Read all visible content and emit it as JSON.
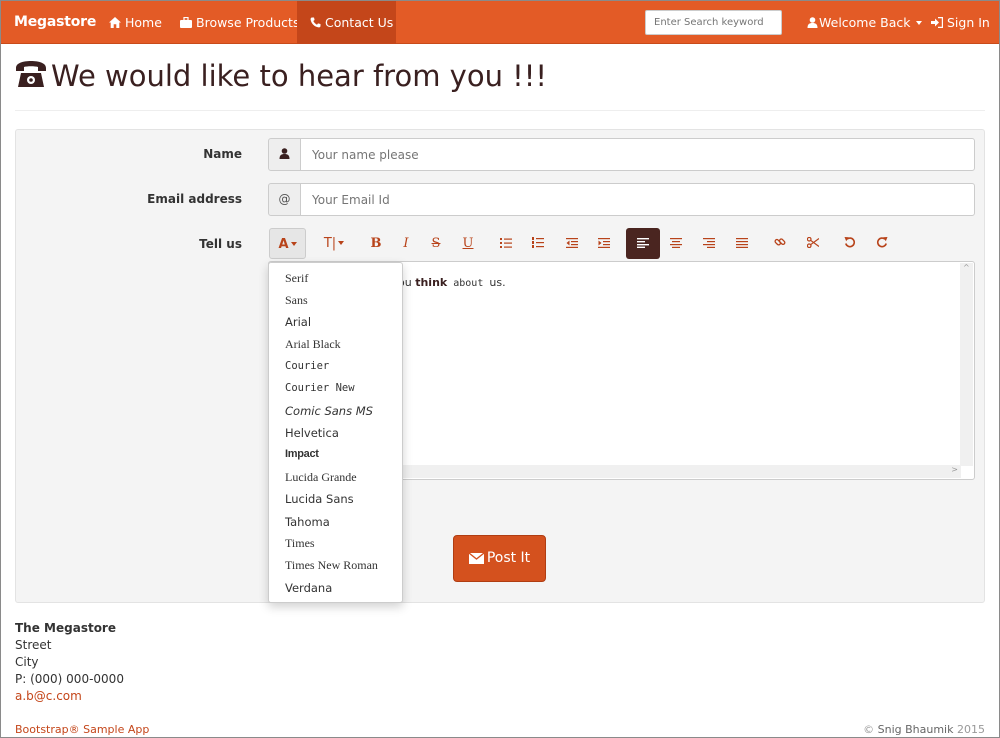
{
  "navbar": {
    "brand": "Megastore",
    "home": "Home",
    "browse": "Browse Products",
    "contact": "Contact Us",
    "search_placeholder": "Enter Search keyword",
    "welcome": "Welcome Back",
    "signin": "Sign In",
    "accent": "#e35b26"
  },
  "heading": {
    "title": "We would like to hear from you !!!"
  },
  "form": {
    "name_label": "Name",
    "name_placeholder": "Your name please",
    "email_label": "Email address",
    "email_addon": "@",
    "email_placeholder": "Your Email Id",
    "tell_label": "Tell us",
    "editor_text_a": "ou ",
    "editor_text_bold": "think",
    "editor_text_mono": " about ",
    "editor_text_b": " us.",
    "submit": "Post It"
  },
  "toolbar": {
    "font": "A",
    "size": "T|",
    "bold": "B",
    "italic": "I",
    "strike": "S",
    "underline": "U"
  },
  "font_menu": {
    "items": [
      "Serif",
      "Sans",
      "Arial",
      "Arial Black",
      "Courier",
      "Courier New",
      "Comic Sans MS",
      "Helvetica",
      "Impact",
      "Lucida Grande",
      "Lucida Sans",
      "Tahoma",
      "Times",
      "Times New Roman",
      "Verdana"
    ]
  },
  "address": {
    "name": "The Megastore",
    "street": "Street",
    "city": "City",
    "phone": "P: (000) 000-0000",
    "email": "a.b@c.com"
  },
  "footer": {
    "left": "Bootstrap® Sample App",
    "copyright": "© ",
    "author": "Snig Bhaumik",
    "year": " 2015"
  }
}
